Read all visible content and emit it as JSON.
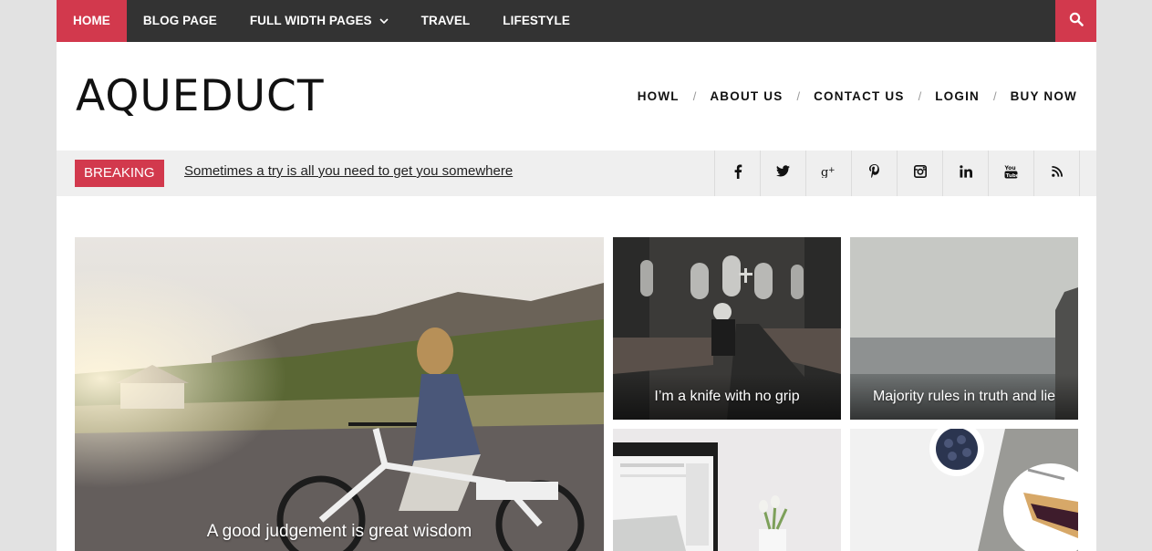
{
  "topnav": {
    "items": [
      {
        "label": "HOME",
        "active": true
      },
      {
        "label": "BLOG PAGE",
        "active": false
      },
      {
        "label": "FULL WIDTH PAGES",
        "active": false,
        "dropdown": true
      },
      {
        "label": "TRAVEL",
        "active": false
      },
      {
        "label": "LIFESTYLE",
        "active": false
      }
    ],
    "search_icon": "search-icon"
  },
  "header": {
    "logo": "AQUEDUCT",
    "nav": [
      "HOWL",
      "ABOUT US",
      "CONTACT US",
      "LOGIN",
      "BUY NOW"
    ],
    "separator": "/"
  },
  "breaking": {
    "label": "BREAKING",
    "headline": "Sometimes a try is all you need to get you somewhere"
  },
  "social": [
    {
      "icon": "facebook-icon",
      "glyph": "f"
    },
    {
      "icon": "twitter-icon",
      "glyph": "t"
    },
    {
      "icon": "google-plus-icon",
      "glyph": "g+"
    },
    {
      "icon": "pinterest-icon",
      "glyph": "p"
    },
    {
      "icon": "instagram-icon",
      "glyph": "ig"
    },
    {
      "icon": "linkedin-icon",
      "glyph": "in"
    },
    {
      "icon": "youtube-icon",
      "glyph": "yt"
    },
    {
      "icon": "rss-icon",
      "glyph": "rss"
    }
  ],
  "posts": {
    "big": {
      "title": "A good judgement is great wisdom"
    },
    "top_1": {
      "title": "I’m a knife with no grip"
    },
    "top_2": {
      "title": "Majority rules in truth and lie"
    }
  },
  "colors": {
    "accent": "#d2394d",
    "topbar": "#333333",
    "breaking_bg": "#efefef"
  }
}
